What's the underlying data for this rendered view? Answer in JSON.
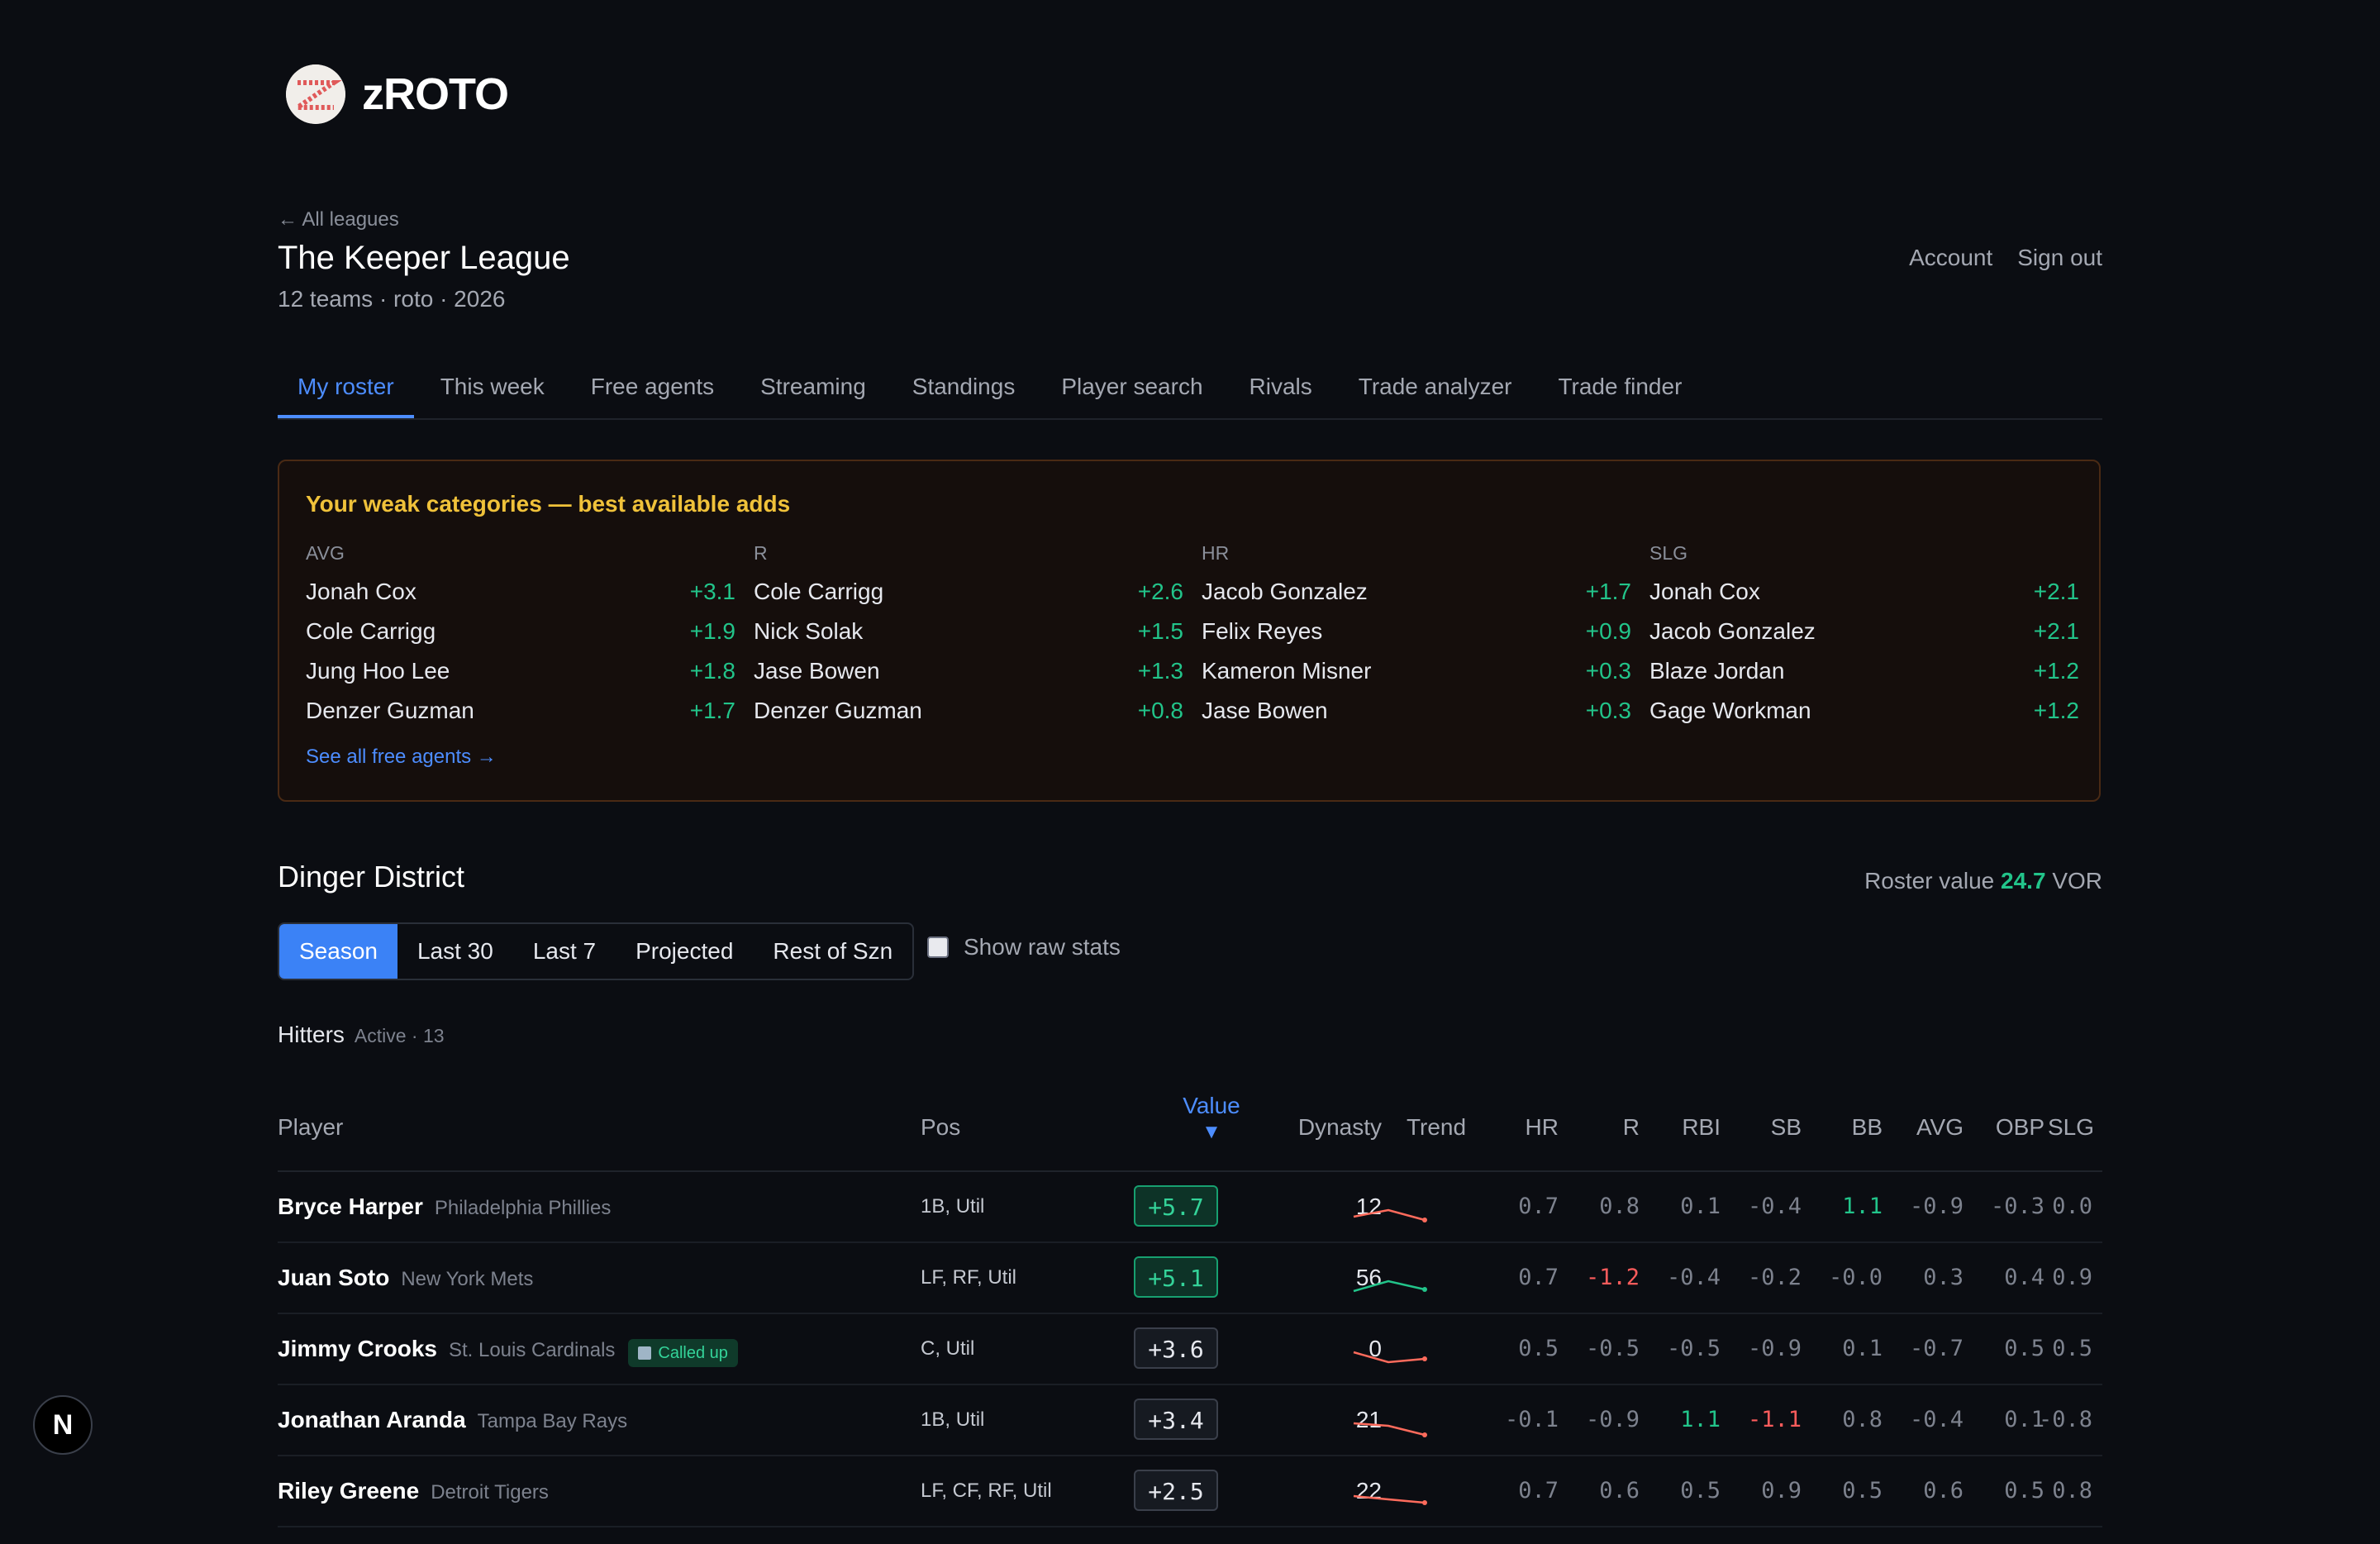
{
  "brand": {
    "name": "zROTO"
  },
  "header": {
    "back_link": "← All leagues",
    "league_title": "The Keeper League",
    "league_sub": "12 teams · roto · 2026",
    "account": "Account",
    "sign_out": "Sign out"
  },
  "tabs": [
    {
      "label": "My roster",
      "active": true
    },
    {
      "label": "This week"
    },
    {
      "label": "Free agents"
    },
    {
      "label": "Streaming"
    },
    {
      "label": "Standings"
    },
    {
      "label": "Player search"
    },
    {
      "label": "Rivals"
    },
    {
      "label": "Trade analyzer"
    },
    {
      "label": "Trade finder"
    }
  ],
  "weak": {
    "title": "Your weak categories — best available adds",
    "link": "See all free agents →",
    "columns": [
      {
        "cat": "AVG",
        "rows": [
          {
            "name": "Jonah Cox",
            "gain": "+3.1"
          },
          {
            "name": "Cole Carrigg",
            "gain": "+1.9"
          },
          {
            "name": "Jung Hoo Lee",
            "gain": "+1.8"
          },
          {
            "name": "Denzer Guzman",
            "gain": "+1.7"
          }
        ]
      },
      {
        "cat": "R",
        "rows": [
          {
            "name": "Cole Carrigg",
            "gain": "+2.6"
          },
          {
            "name": "Nick Solak",
            "gain": "+1.5"
          },
          {
            "name": "Jase Bowen",
            "gain": "+1.3"
          },
          {
            "name": "Denzer Guzman",
            "gain": "+0.8"
          }
        ]
      },
      {
        "cat": "HR",
        "rows": [
          {
            "name": "Jacob Gonzalez",
            "gain": "+1.7"
          },
          {
            "name": "Felix Reyes",
            "gain": "+0.9"
          },
          {
            "name": "Kameron Misner",
            "gain": "+0.3"
          },
          {
            "name": "Jase Bowen",
            "gain": "+0.3"
          }
        ]
      },
      {
        "cat": "SLG",
        "rows": [
          {
            "name": "Jonah Cox",
            "gain": "+2.1"
          },
          {
            "name": "Jacob Gonzalez",
            "gain": "+2.1"
          },
          {
            "name": "Blaze Jordan",
            "gain": "+1.2"
          },
          {
            "name": "Gage Workman",
            "gain": "+1.2"
          }
        ]
      }
    ]
  },
  "team": {
    "name": "Dinger District",
    "roster_value_label": "Roster value",
    "roster_value": "24.7",
    "roster_value_unit": "VOR"
  },
  "periods": [
    {
      "label": "Season",
      "active": true
    },
    {
      "label": "Last 30"
    },
    {
      "label": "Last 7"
    },
    {
      "label": "Projected"
    },
    {
      "label": "Rest of Szn"
    }
  ],
  "show_raw_label": "Show raw stats",
  "section": {
    "title": "Hitters",
    "sub": "Active · 13"
  },
  "table": {
    "headers": {
      "player": "Player",
      "pos": "Pos",
      "value": "Value",
      "value_sort": "▼",
      "dynasty": "Dynasty",
      "trend": "Trend",
      "stats": [
        "HR",
        "R",
        "RBI",
        "SB",
        "BB",
        "AVG",
        "OBP",
        "SLG"
      ]
    },
    "rows": [
      {
        "name": "Bryce Harper",
        "team": "Philadelphia Phillies",
        "badge": "",
        "pos": "1B, Util",
        "value": "+5.7",
        "value_style": "pos-hi",
        "dynasty": "12",
        "trend": [
          10,
          2,
          14
        ],
        "trend_color": "#ff6b5c",
        "stats": [
          "0.7",
          "0.8",
          "0.1",
          "-0.4",
          "1.1",
          "-0.9",
          "-0.3",
          "0.0"
        ],
        "stat_styles": [
          "",
          "",
          "",
          "",
          "g",
          "",
          "",
          ""
        ]
      },
      {
        "name": "Juan Soto",
        "team": "New York Mets",
        "badge": "",
        "pos": "LF, RF, Util",
        "value": "+5.1",
        "value_style": "pos-hi",
        "dynasty": "56",
        "trend": [
          14,
          2,
          12
        ],
        "trend_color": "#22c48a",
        "stats": [
          "0.7",
          "-1.2",
          "-0.4",
          "-0.2",
          "-0.0",
          "0.3",
          "0.4",
          "0.9"
        ],
        "stat_styles": [
          "",
          "r",
          "",
          "",
          "",
          "",
          "",
          ""
        ]
      },
      {
        "name": "Jimmy Crooks",
        "team": "St. Louis Cardinals",
        "badge": "Called up",
        "pos": "C, Util",
        "value": "+3.6",
        "value_style": "neutral",
        "dynasty": "0",
        "trend": [
          2,
          14,
          10
        ],
        "trend_color": "#ff6b5c",
        "stats": [
          "0.5",
          "-0.5",
          "-0.5",
          "-0.9",
          "0.1",
          "-0.7",
          "0.5",
          "0.5"
        ],
        "stat_styles": [
          "",
          "",
          "",
          "",
          "",
          "",
          "",
          ""
        ]
      },
      {
        "name": "Jonathan Aranda",
        "team": "Tampa Bay Rays",
        "badge": "",
        "pos": "1B, Util",
        "value": "+3.4",
        "value_style": "neutral",
        "dynasty": "21",
        "trend": [
          2,
          5,
          16
        ],
        "trend_color": "#ff6b5c",
        "stats": [
          "-0.1",
          "-0.9",
          "1.1",
          "-1.1",
          "0.8",
          "-0.4",
          "0.1",
          "-0.8"
        ],
        "stat_styles": [
          "",
          "",
          "g",
          "r",
          "",
          "",
          "",
          ""
        ]
      },
      {
        "name": "Riley Greene",
        "team": "Detroit Tigers",
        "badge": "",
        "pos": "LF, CF, RF, Util",
        "value": "+2.5",
        "value_style": "neutral",
        "dynasty": "22",
        "trend": [
          4,
          8,
          12
        ],
        "trend_color": "#ff6b5c",
        "stats": [
          "0.7",
          "0.6",
          "0.5",
          "0.9",
          "0.5",
          "0.6",
          "0.5",
          "0.8"
        ],
        "stat_styles": [
          "",
          "",
          "",
          "",
          "",
          "",
          "",
          ""
        ]
      }
    ]
  },
  "fab_label": "N"
}
